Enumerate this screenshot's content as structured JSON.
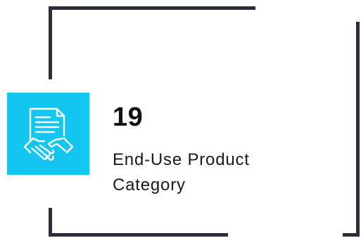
{
  "stat": {
    "value": "19",
    "label": "End-Use Product\nCategory"
  },
  "icon": "document-handshake-icon",
  "colors": {
    "accent": "#12c6ef",
    "frame": "#2a2f3b",
    "text": "#111111"
  }
}
